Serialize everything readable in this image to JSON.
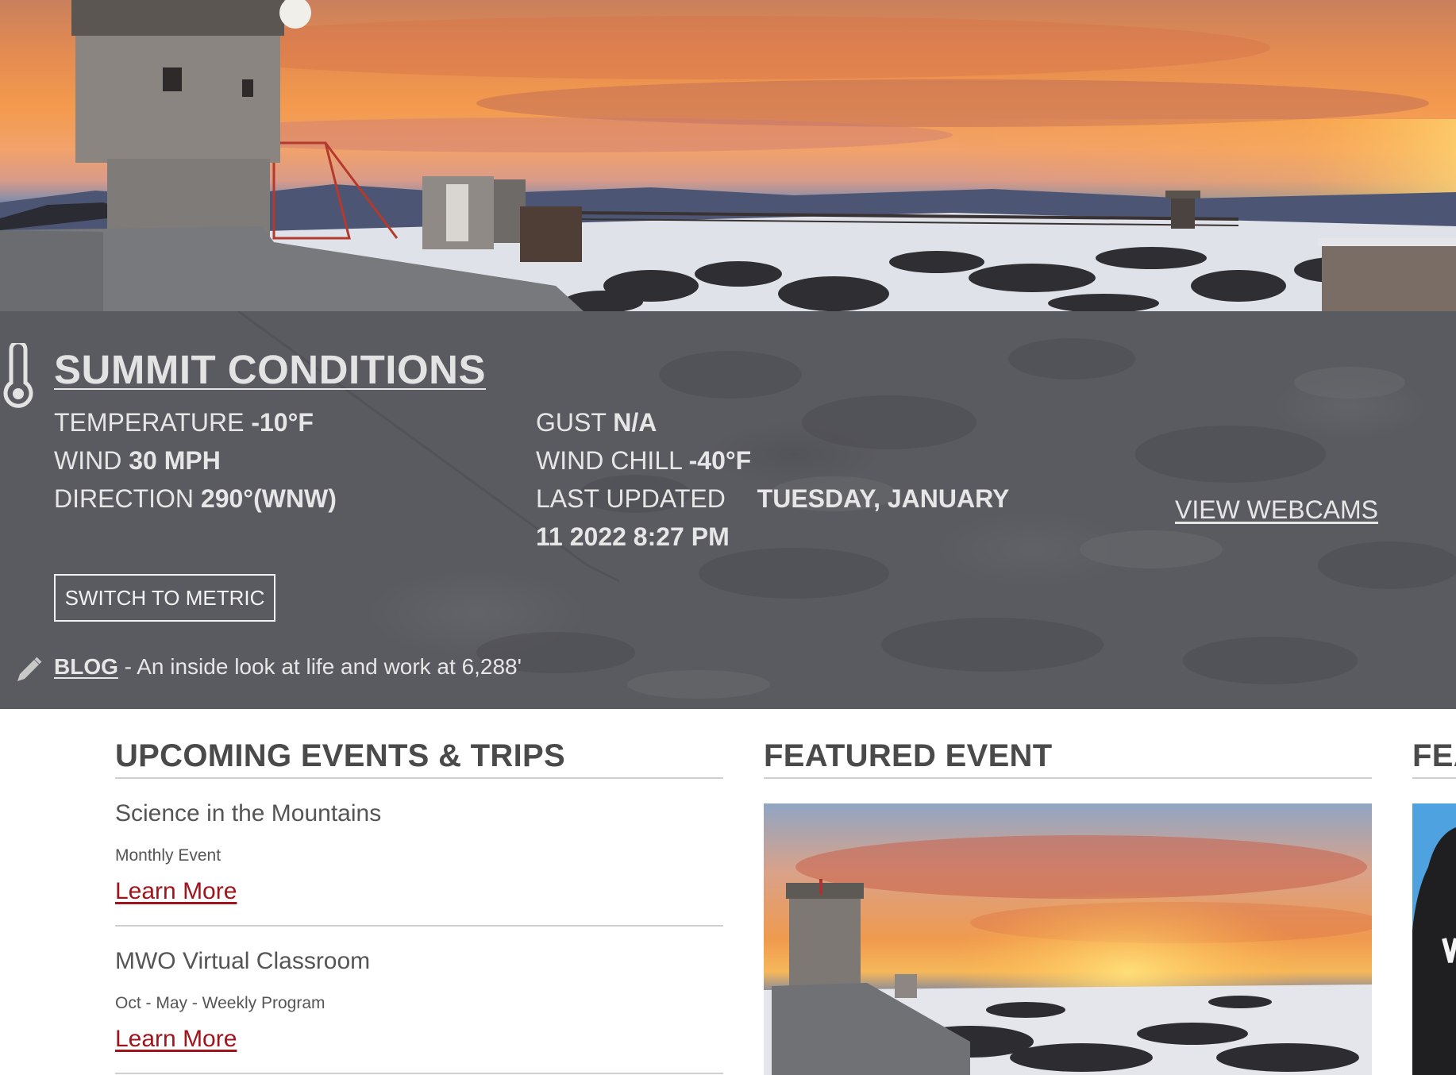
{
  "conditions": {
    "title": "SUMMIT CONDITIONS",
    "temperature_label": "TEMPERATURE",
    "temperature_value": "-10°F",
    "wind_label": "WIND",
    "wind_value": "30 MPH",
    "direction_label": "DIRECTION",
    "direction_value": "290°(WNW)",
    "gust_label": "GUST",
    "gust_value": "N/A",
    "wind_chill_label": "WIND CHILL",
    "wind_chill_value": "-40°F",
    "last_updated_label": "LAST UPDATED",
    "last_updated_value_line1": "TUESDAY, JANUARY",
    "last_updated_value_line2": "11 2022 8:27 PM",
    "webcams_link": "VIEW WEBCAMS",
    "metric_button": "SWITCH TO METRIC",
    "blog_link": "BLOG",
    "blog_tagline": " - An inside look at life and work at 6,288'"
  },
  "events": {
    "heading": "UPCOMING EVENTS & TRIPS",
    "items": [
      {
        "title": "Science in the Mountains",
        "meta": "Monthly Event",
        "link": "Learn More"
      },
      {
        "title": "MWO Virtual Classroom",
        "meta": "Oct - May - Weekly Program",
        "link": "Learn More"
      }
    ]
  },
  "featured": {
    "heading": "FEATURED EVENT"
  },
  "third_column": {
    "heading": "FEA"
  },
  "colors": {
    "panel_bg": "#5a5b60",
    "link_red": "#a0151c",
    "heading_gray": "#4a4a4a"
  },
  "icons": {
    "conditions": "thermometer-icon",
    "blog": "pencil-icon"
  }
}
